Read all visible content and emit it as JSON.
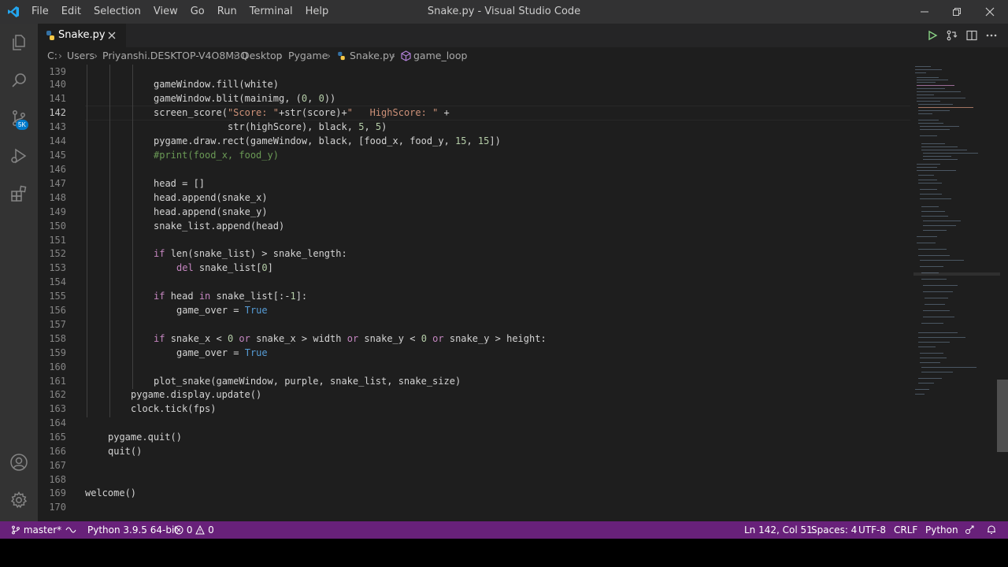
{
  "app": {
    "window_title": "Snake.py - Visual Studio Code",
    "icon": "vscode-logo-icon"
  },
  "menu": [
    "File",
    "Edit",
    "Selection",
    "View",
    "Go",
    "Run",
    "Terminal",
    "Help"
  ],
  "window_controls": {
    "minimize_icon": "minimize-icon",
    "restore_icon": "restore-icon",
    "close_icon": "close-icon"
  },
  "activity_bar": {
    "top": [
      "explorer-icon",
      "search-icon",
      "source-control-icon",
      "run-debug-icon",
      "extensions-icon"
    ],
    "scm_badge": "5K",
    "bottom": [
      "account-icon",
      "manage-gear-icon"
    ]
  },
  "tab": {
    "label": "Snake.py",
    "icon": "python-file-icon",
    "close": "close-icon"
  },
  "tab_actions": [
    "run-python-file-icon",
    "open-changes-icon",
    "split-editor-icon",
    "more-actions-icon"
  ],
  "breadcrumb": [
    "C:",
    "Users",
    "Priyanshi.DESKTOP-V4O8M3Q",
    "Desktop",
    "Pygame",
    "Snake.py",
    "game_loop"
  ],
  "editor": {
    "current_line": 142,
    "lines": [
      {
        "n": "139",
        "code": ""
      },
      {
        "n": "140",
        "code": "gameWindow.fill(white)"
      },
      {
        "n": "141",
        "code": "gameWindow.blit(mainimg, (0, 0))"
      },
      {
        "n": "142",
        "code": "screen_score(\"Score: \"+str(score)+\"   HighScore: \" +"
      },
      {
        "n": "143",
        "code": "str(highScore), black, 5, 5)"
      },
      {
        "n": "144",
        "code": "pygame.draw.rect(gameWindow, black, [food_x, food_y, 15, 15])"
      },
      {
        "n": "145",
        "code": "#print(food_x, food_y)"
      },
      {
        "n": "146",
        "code": ""
      },
      {
        "n": "147",
        "code": "head = []"
      },
      {
        "n": "148",
        "code": "head.append(snake_x)"
      },
      {
        "n": "149",
        "code": "head.append(snake_y)"
      },
      {
        "n": "150",
        "code": "snake_list.append(head)"
      },
      {
        "n": "151",
        "code": ""
      },
      {
        "n": "152",
        "code": "if len(snake_list) > snake_length:"
      },
      {
        "n": "153",
        "code": "del snake_list[0]"
      },
      {
        "n": "154",
        "code": ""
      },
      {
        "n": "155",
        "code": "if head in snake_list[:-1]:"
      },
      {
        "n": "156",
        "code": "game_over = True"
      },
      {
        "n": "157",
        "code": ""
      },
      {
        "n": "158",
        "code": "if snake_x < 0 or snake_x > width or snake_y < 0 or snake_y > height:"
      },
      {
        "n": "159",
        "code": "game_over = True"
      },
      {
        "n": "160",
        "code": ""
      },
      {
        "n": "161",
        "code": "plot_snake(gameWindow, purple, snake_list, snake_size)"
      },
      {
        "n": "162",
        "code": "pygame.display.update()"
      },
      {
        "n": "163",
        "code": "clock.tick(fps)"
      },
      {
        "n": "164",
        "code": ""
      },
      {
        "n": "165",
        "code": "pygame.quit()"
      },
      {
        "n": "166",
        "code": "quit()"
      },
      {
        "n": "167",
        "code": ""
      },
      {
        "n": "168",
        "code": ""
      },
      {
        "n": "169",
        "code": "welcome()"
      },
      {
        "n": "170",
        "code": ""
      }
    ]
  },
  "status": {
    "branch": "master*",
    "sync_icon": "live-share-icon",
    "interpreter": "Python 3.9.5 64-bit",
    "errors": "0",
    "warnings": "0",
    "position": "Ln 142, Col 51",
    "spaces": "Spaces: 4",
    "encoding": "UTF-8",
    "eol": "CRLF",
    "language": "Python",
    "feedback_icon": "feedback-icon",
    "bell_icon": "notifications-bell-icon"
  },
  "colors": {
    "status_bar": "#68217a",
    "editor_bg": "#1e1e1e",
    "title_bar": "#323233",
    "activity_bar": "#333333",
    "keyword": "#c586c0",
    "string": "#ce9178",
    "number": "#b5cea8",
    "comment": "#6a9955",
    "accent": "#007acc"
  }
}
